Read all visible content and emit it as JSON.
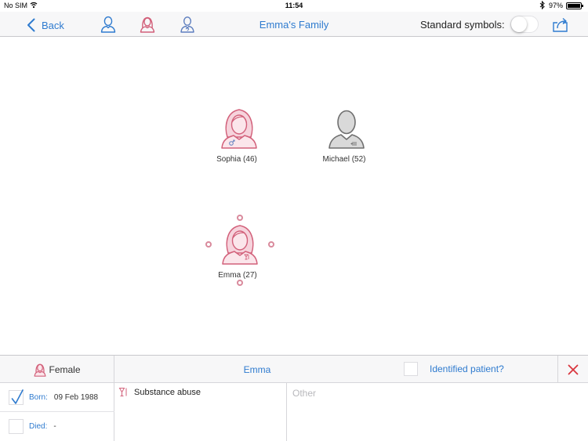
{
  "status_bar": {
    "carrier": "No SIM",
    "time": "11:54",
    "battery": "97%",
    "battery_level": 0.97
  },
  "navbar": {
    "back_label": "Back",
    "title": "Emma's Family",
    "standard_symbols_label": "Standard symbols:",
    "standard_symbols_on": false,
    "icons": [
      "add-male-icon",
      "add-female-icon",
      "add-unknown-icon",
      "share-icon"
    ]
  },
  "colors": {
    "accent": "#2f7bcf",
    "female": "#d2607a",
    "male": "#6f6f6f",
    "close": "#d9363e"
  },
  "pedigree": {
    "people": [
      {
        "label": "Sophia (46)",
        "sex": "female",
        "selected": false
      },
      {
        "label": "Michael (52)",
        "sex": "male",
        "selected": false
      },
      {
        "label": "Emma (27)",
        "sex": "female",
        "selected": true
      }
    ]
  },
  "detail": {
    "gender": "Female",
    "name": "Emma",
    "identified_patient_label": "Identified patient?",
    "identified_patient": false,
    "born": {
      "label": "Born:",
      "value": "09 Feb 1988",
      "checked": true
    },
    "died": {
      "label": "Died:",
      "value": "-",
      "checked": false
    },
    "conditions": [
      "Substance abuse"
    ],
    "other_placeholder": "Other"
  }
}
